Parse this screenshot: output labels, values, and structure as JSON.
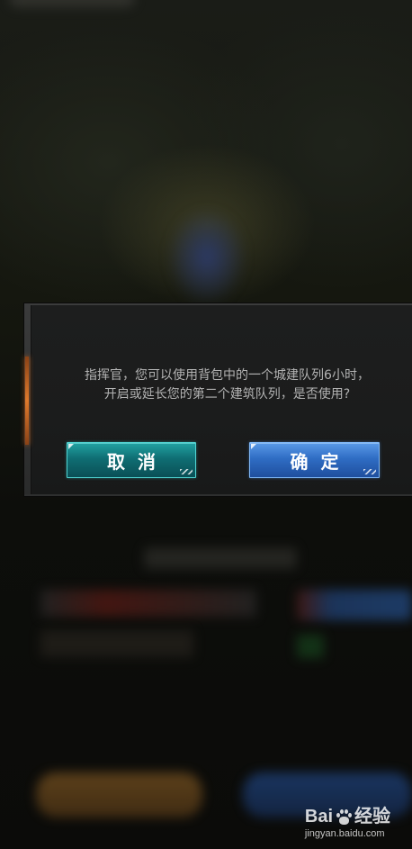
{
  "dialog": {
    "message_lines": [
      "指挥官，您可以使用背包中的一个城建队列6小时，",
      "开启或延长您的第二个建筑队列，是否使用?"
    ],
    "cancel_label": "取消",
    "confirm_label": "确定"
  },
  "watermark": {
    "brand_prefix": "Bai",
    "brand_suffix": "经验",
    "url": "jingyan.baidu.com",
    "icon": "baidu-paw-icon"
  },
  "colors": {
    "cancel_button": "#0f6e73",
    "confirm_button": "#2f6dc4",
    "accent": "#e07a2c"
  }
}
